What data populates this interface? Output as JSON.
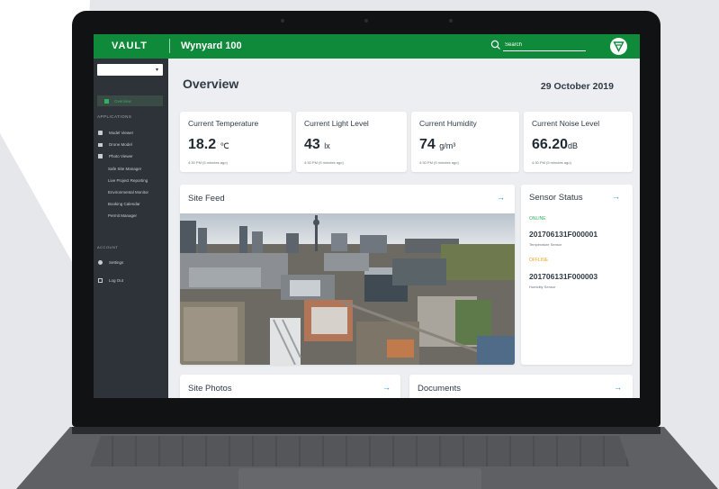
{
  "app": {
    "logo": "VAULT",
    "project": "Wynyard 100"
  },
  "search": {
    "placeholder": "Search"
  },
  "sidebar": {
    "site_select_value": "",
    "overview_label": "Overview",
    "applications_heading": "APPLICATIONS",
    "items": [
      {
        "label": "Model Viewer",
        "icon": "cube-icon"
      },
      {
        "label": "Drone Model",
        "icon": "video-icon"
      },
      {
        "label": "Photo Viewer",
        "icon": "image-icon"
      }
    ],
    "sub_items": [
      "Safe Site Manager",
      "Live Project Reporting",
      "Environmental Monitor",
      "Booking Calendar",
      "Permit Manager"
    ],
    "account_heading": "ACCOUNT",
    "settings_label": "Settings",
    "logout_label": "Log Out"
  },
  "page": {
    "title": "Overview",
    "date": "29 October 2019"
  },
  "metrics": [
    {
      "title": "Current Temperature",
      "value": "18.2",
      "unit": "℃",
      "time": "4:30 PM (5 minutes ago)"
    },
    {
      "title": "Current Light Level",
      "value": "43",
      "unit": "lx",
      "time": "4:30 PM (5 minutes ago)"
    },
    {
      "title": "Current Humidity",
      "value": "74",
      "unit": "g/m³",
      "time": "4:30 PM (5 minutes ago)"
    },
    {
      "title": "Current Noise Level",
      "value": "66.20",
      "unit": "dB",
      "time": "4:30 PM (5 minutes ago)"
    }
  ],
  "site_feed": {
    "title": "Site Feed"
  },
  "sensor_status": {
    "title": "Sensor Status",
    "sensors": [
      {
        "status": "ONLINE",
        "id": "201706131F000001",
        "type": "Temperature Sensor",
        "color": "#2fb15f"
      },
      {
        "status": "OFFLINE",
        "id": "201706131F000003",
        "type": "Humidity Sensor",
        "color": "#f0a22a"
      }
    ]
  },
  "site_photos": {
    "title": "Site Photos"
  },
  "documents": {
    "title": "Documents"
  },
  "colors": {
    "brand_green": "#0f8a3a",
    "sidebar": "#2e333a",
    "accent_blue": "#1a8fd6"
  }
}
